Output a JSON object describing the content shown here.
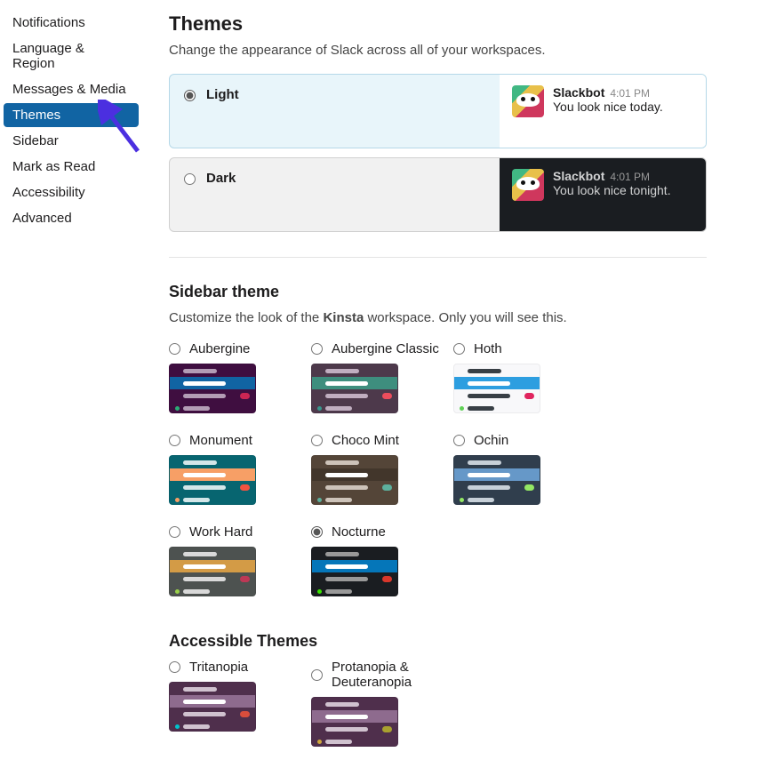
{
  "sidebar": {
    "items": [
      {
        "label": "Notifications"
      },
      {
        "label": "Language & Region"
      },
      {
        "label": "Messages & Media"
      },
      {
        "label": "Themes",
        "active": true
      },
      {
        "label": "Sidebar"
      },
      {
        "label": "Mark as Read"
      },
      {
        "label": "Accessibility"
      },
      {
        "label": "Advanced"
      }
    ]
  },
  "themes": {
    "title": "Themes",
    "subtitle": "Change the appearance of Slack across all of your workspaces.",
    "options": {
      "light": {
        "name": "Light",
        "selected": true,
        "bot_name": "Slackbot",
        "bot_time": "4:01 PM",
        "bot_msg": "You look nice today."
      },
      "dark": {
        "name": "Dark",
        "selected": false,
        "bot_name": "Slackbot",
        "bot_time": "4:01 PM",
        "bot_msg": "You look nice tonight."
      }
    }
  },
  "sidebar_theme": {
    "title": "Sidebar theme",
    "subtitle_pre": "Customize the look of the ",
    "subtitle_bold": "Kinsta",
    "subtitle_post": " workspace. Only you will see this.",
    "items": [
      {
        "label": "Aubergine",
        "bg": "#3f0e40",
        "active": "#1164a3",
        "text": "#b39cb5",
        "badge": "#cd2553",
        "presence": "#2bac76"
      },
      {
        "label": "Aubergine Classic",
        "bg": "#4d394b",
        "active": "#3e8e7e",
        "text": "#c0aec0",
        "badge": "#eb4d5c",
        "presence": "#38968d"
      },
      {
        "label": "Hoth",
        "bg": "#f8f8fa",
        "active": "#2d9ee0",
        "text": "#383f45",
        "badge": "#e0245e",
        "presence": "#60d156"
      },
      {
        "label": "Monument",
        "bg": "#076570",
        "active": "#f79f66",
        "text": "#d3e6e8",
        "badge": "#f15340",
        "presence": "#f79f66"
      },
      {
        "label": "Choco Mint",
        "bg": "#544538",
        "active": "#42362b",
        "text": "#cdc3b9",
        "badge": "#5db09d",
        "presence": "#5db09d"
      },
      {
        "label": "Ochin",
        "bg": "#303e4d",
        "active": "#6698c8",
        "text": "#c7d0d8",
        "badge": "#94e864",
        "presence": "#94e864"
      },
      {
        "label": "Work Hard",
        "bg": "#4d5250",
        "active": "#d39b46",
        "text": "#d9d9d9",
        "badge": "#bd3855",
        "presence": "#99d04a"
      },
      {
        "label": "Nocturne",
        "selected": true,
        "bg": "#1a1d21",
        "active": "#0576b9",
        "text": "#999999",
        "badge": "#d9372b",
        "presence": "#39e500"
      }
    ]
  },
  "accessible_themes": {
    "title": "Accessible Themes",
    "items": [
      {
        "label": "Tritanopia",
        "bg": "#4f2f4c",
        "active": "#8e6b8e",
        "text": "#d0c2cf",
        "badge": "#d94d3c",
        "presence": "#00c4cc"
      },
      {
        "label": "Protanopia & Deuteranopia",
        "bg": "#4f2f4c",
        "active": "#8e6b8e",
        "text": "#d0c2cf",
        "badge": "#a9a12f",
        "presence": "#d0a83b"
      }
    ]
  }
}
